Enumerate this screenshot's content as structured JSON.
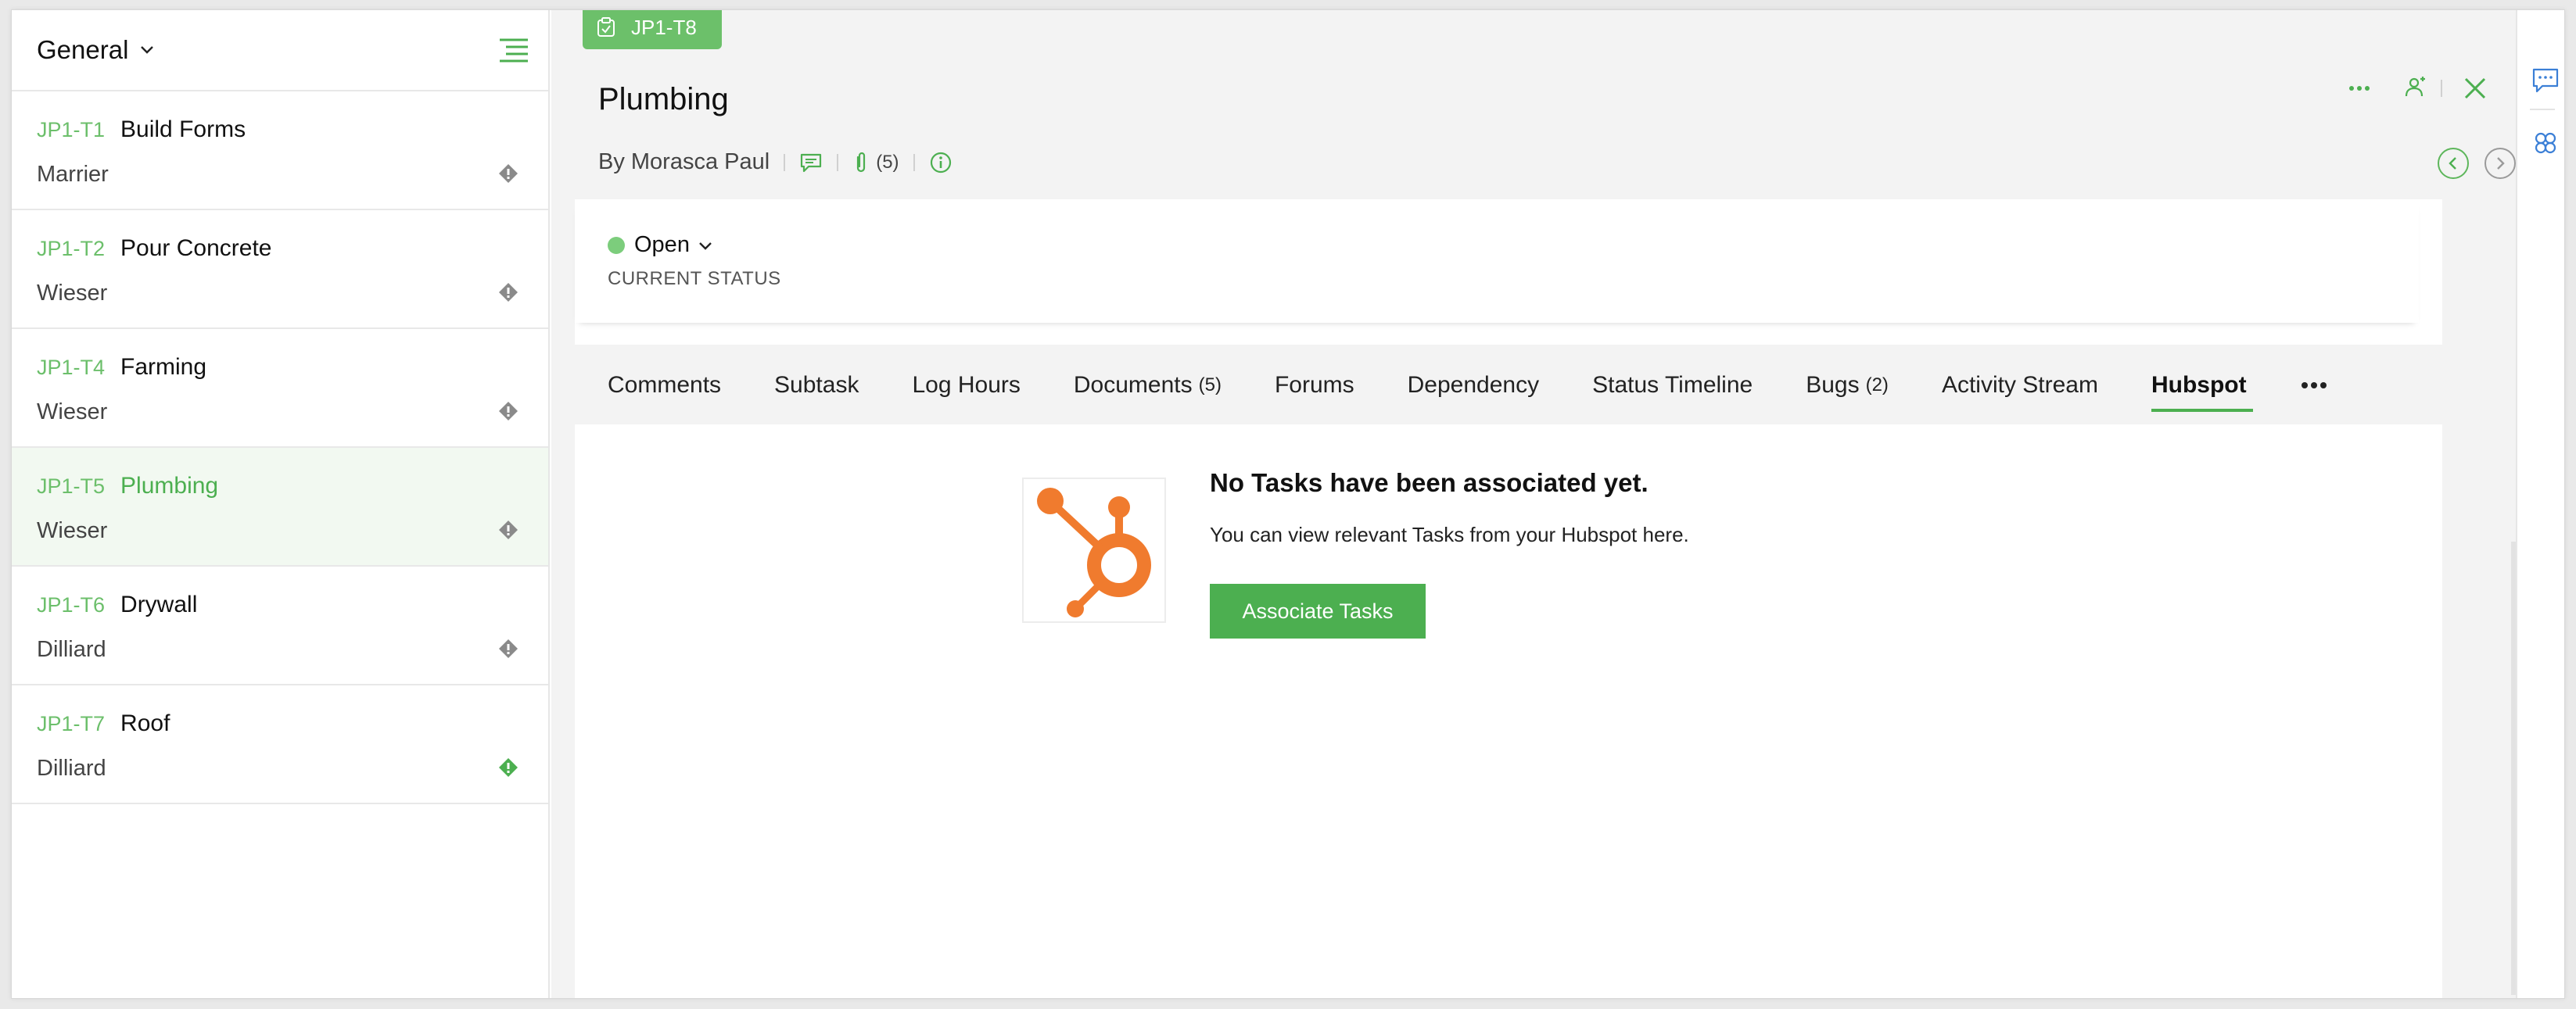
{
  "sidebar": {
    "title": "General",
    "items": [
      {
        "id": "JP1-T1",
        "name": "Build Forms",
        "owner": "Marrier",
        "active": false,
        "flag_color": "#8a8a8a"
      },
      {
        "id": "JP1-T2",
        "name": "Pour Concrete",
        "owner": "Wieser",
        "active": false,
        "flag_color": "#8a8a8a"
      },
      {
        "id": "JP1-T4",
        "name": "Farming",
        "owner": "Wieser",
        "active": false,
        "flag_color": "#8a8a8a"
      },
      {
        "id": "JP1-T5",
        "name": "Plumbing",
        "owner": "Wieser",
        "active": true,
        "flag_color": "#8a8a8a"
      },
      {
        "id": "JP1-T6",
        "name": "Drywall",
        "owner": "Dilliard",
        "active": false,
        "flag_color": "#8a8a8a"
      },
      {
        "id": "JP1-T7",
        "name": "Roof",
        "owner": "Dilliard",
        "active": false,
        "flag_color": "#4caf50"
      }
    ]
  },
  "task": {
    "badge": "JP1-T8",
    "title": "Plumbing",
    "by": "By Morasca Paul",
    "attachments_count": "(5)"
  },
  "status": {
    "value": "Open",
    "label": "CURRENT STATUS",
    "color": "#7ccd7c"
  },
  "tabs": [
    {
      "label": "Comments",
      "count": ""
    },
    {
      "label": "Subtask",
      "count": ""
    },
    {
      "label": "Log Hours",
      "count": ""
    },
    {
      "label": "Documents",
      "count": "(5)"
    },
    {
      "label": "Forums",
      "count": ""
    },
    {
      "label": "Dependency",
      "count": ""
    },
    {
      "label": "Status Timeline",
      "count": ""
    },
    {
      "label": "Bugs",
      "count": "(2)"
    },
    {
      "label": "Activity Stream",
      "count": ""
    },
    {
      "label": "Hubspot",
      "count": "",
      "active": true
    }
  ],
  "hubspot": {
    "empty_title": "No Tasks have been associated yet.",
    "empty_desc": "You can view relevant Tasks from your Hubspot here.",
    "button": "Associate Tasks"
  },
  "colors": {
    "accent": "#4caf50",
    "hubspot_orange": "#f07b2e"
  }
}
